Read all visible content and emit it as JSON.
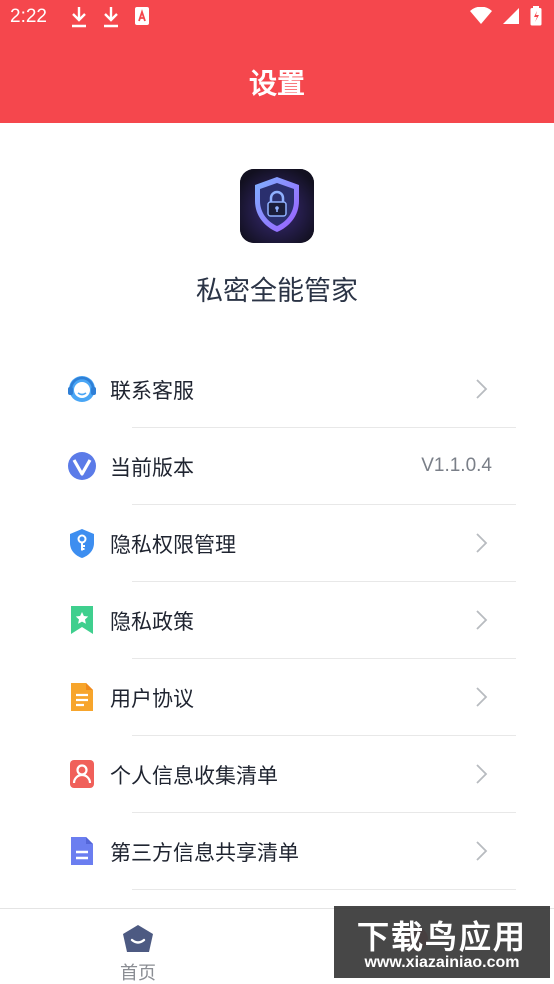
{
  "status_bar": {
    "time": "2:22"
  },
  "header": {
    "title": "设置"
  },
  "app": {
    "name": "私密全能管家"
  },
  "menu": {
    "items": [
      {
        "label": "联系客服",
        "icon": "customer-service-icon"
      },
      {
        "label": "当前版本",
        "icon": "version-icon",
        "value": "V1.1.0.4"
      },
      {
        "label": "隐私权限管理",
        "icon": "privacy-permission-icon"
      },
      {
        "label": "隐私政策",
        "icon": "privacy-policy-icon"
      },
      {
        "label": "用户协议",
        "icon": "user-agreement-icon"
      },
      {
        "label": "个人信息收集清单",
        "icon": "personal-info-icon"
      },
      {
        "label": "第三方信息共享清单",
        "icon": "third-party-share-icon"
      }
    ]
  },
  "bottom_nav": {
    "home_label": "首页"
  },
  "watermark": {
    "text": "下载鸟应用",
    "url": "www.xiazainiao.com"
  },
  "colors": {
    "brand": "#f5474d",
    "text": "#1f2430",
    "muted": "#7a7f88"
  }
}
